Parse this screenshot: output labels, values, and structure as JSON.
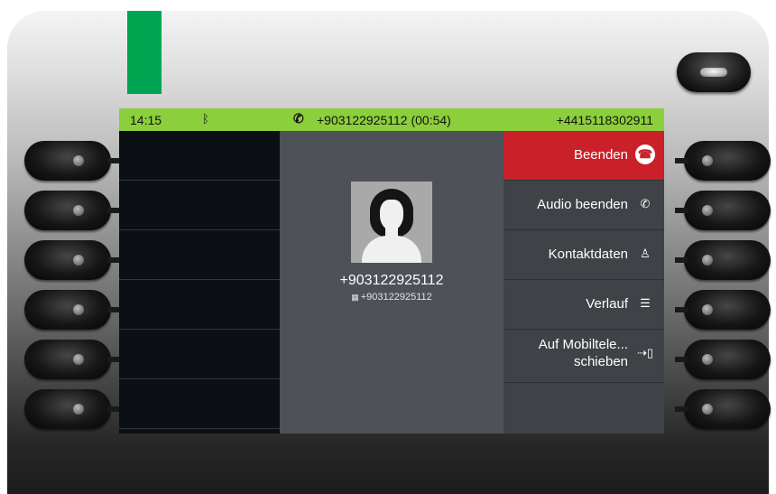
{
  "status_bar": {
    "time": "14:15",
    "call_info": "+903122925112 (00:54)",
    "own_number": "+4415118302911",
    "bluetooth_icon": "bluetooth-icon",
    "call_icon": "phone-call-icon",
    "background_color": "#8ccf3c"
  },
  "caller": {
    "number": "+903122925112",
    "sub_number": "+903122925112",
    "avatar_icon": "person-avatar-icon"
  },
  "menu": {
    "items": [
      {
        "label": "Beenden",
        "icon": "hangup-icon",
        "active": true
      },
      {
        "label": "Audio beenden",
        "icon": "audio-off-icon",
        "active": false
      },
      {
        "label": "Kontaktdaten",
        "icon": "contact-icon",
        "active": false
      },
      {
        "label": "Verlauf",
        "icon": "list-icon",
        "active": false
      },
      {
        "label_line1": "Auf Mobiltele...",
        "label_line2": "schieben",
        "icon": "transfer-mobile-icon",
        "active": false
      },
      {
        "label": "",
        "icon": "",
        "active": false
      }
    ]
  },
  "colors": {
    "accent_green": "#00a551",
    "active_red": "#c9202a"
  }
}
